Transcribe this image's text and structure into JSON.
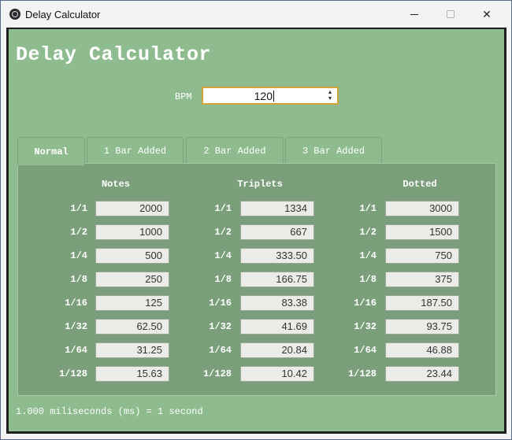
{
  "window": {
    "title": "Delay Calculator",
    "minimize_glyph": "—",
    "maximize_glyph": "☐",
    "close_glyph": "✕"
  },
  "app": {
    "heading": "Delay Calculator",
    "bpm_label": "BPM",
    "bpm_value": "120",
    "footer": "1.000 miliseconds (ms) = 1 second"
  },
  "tabs": [
    {
      "label": "Normal",
      "active": true
    },
    {
      "label": "1 Bar Added",
      "active": false
    },
    {
      "label": "2 Bar Added",
      "active": false
    },
    {
      "label": "3 Bar Added",
      "active": false
    }
  ],
  "columns": [
    {
      "header": "Notes",
      "rows": [
        {
          "label": "1/1",
          "value": "2000"
        },
        {
          "label": "1/2",
          "value": "1000"
        },
        {
          "label": "1/4",
          "value": "500"
        },
        {
          "label": "1/8",
          "value": "250"
        },
        {
          "label": "1/16",
          "value": "125"
        },
        {
          "label": "1/32",
          "value": "62.50"
        },
        {
          "label": "1/64",
          "value": "31.25"
        },
        {
          "label": "1/128",
          "value": "15.63"
        }
      ]
    },
    {
      "header": "Triplets",
      "rows": [
        {
          "label": "1/1",
          "value": "1334"
        },
        {
          "label": "1/2",
          "value": "667"
        },
        {
          "label": "1/4",
          "value": "333.50"
        },
        {
          "label": "1/8",
          "value": "166.75"
        },
        {
          "label": "1/16",
          "value": "83.38"
        },
        {
          "label": "1/32",
          "value": "41.69"
        },
        {
          "label": "1/64",
          "value": "20.84"
        },
        {
          "label": "1/128",
          "value": "10.42"
        }
      ]
    },
    {
      "header": "Dotted",
      "rows": [
        {
          "label": "1/1",
          "value": "3000"
        },
        {
          "label": "1/2",
          "value": "1500"
        },
        {
          "label": "1/4",
          "value": "750"
        },
        {
          "label": "1/8",
          "value": "375"
        },
        {
          "label": "1/16",
          "value": "187.50"
        },
        {
          "label": "1/32",
          "value": "93.75"
        },
        {
          "label": "1/64",
          "value": "46.88"
        },
        {
          "label": "1/128",
          "value": "23.44"
        }
      ]
    }
  ],
  "colors": {
    "background": "#8fbc8f",
    "panel": "#7b9f7b",
    "input_focus_border": "#d1a33a"
  }
}
